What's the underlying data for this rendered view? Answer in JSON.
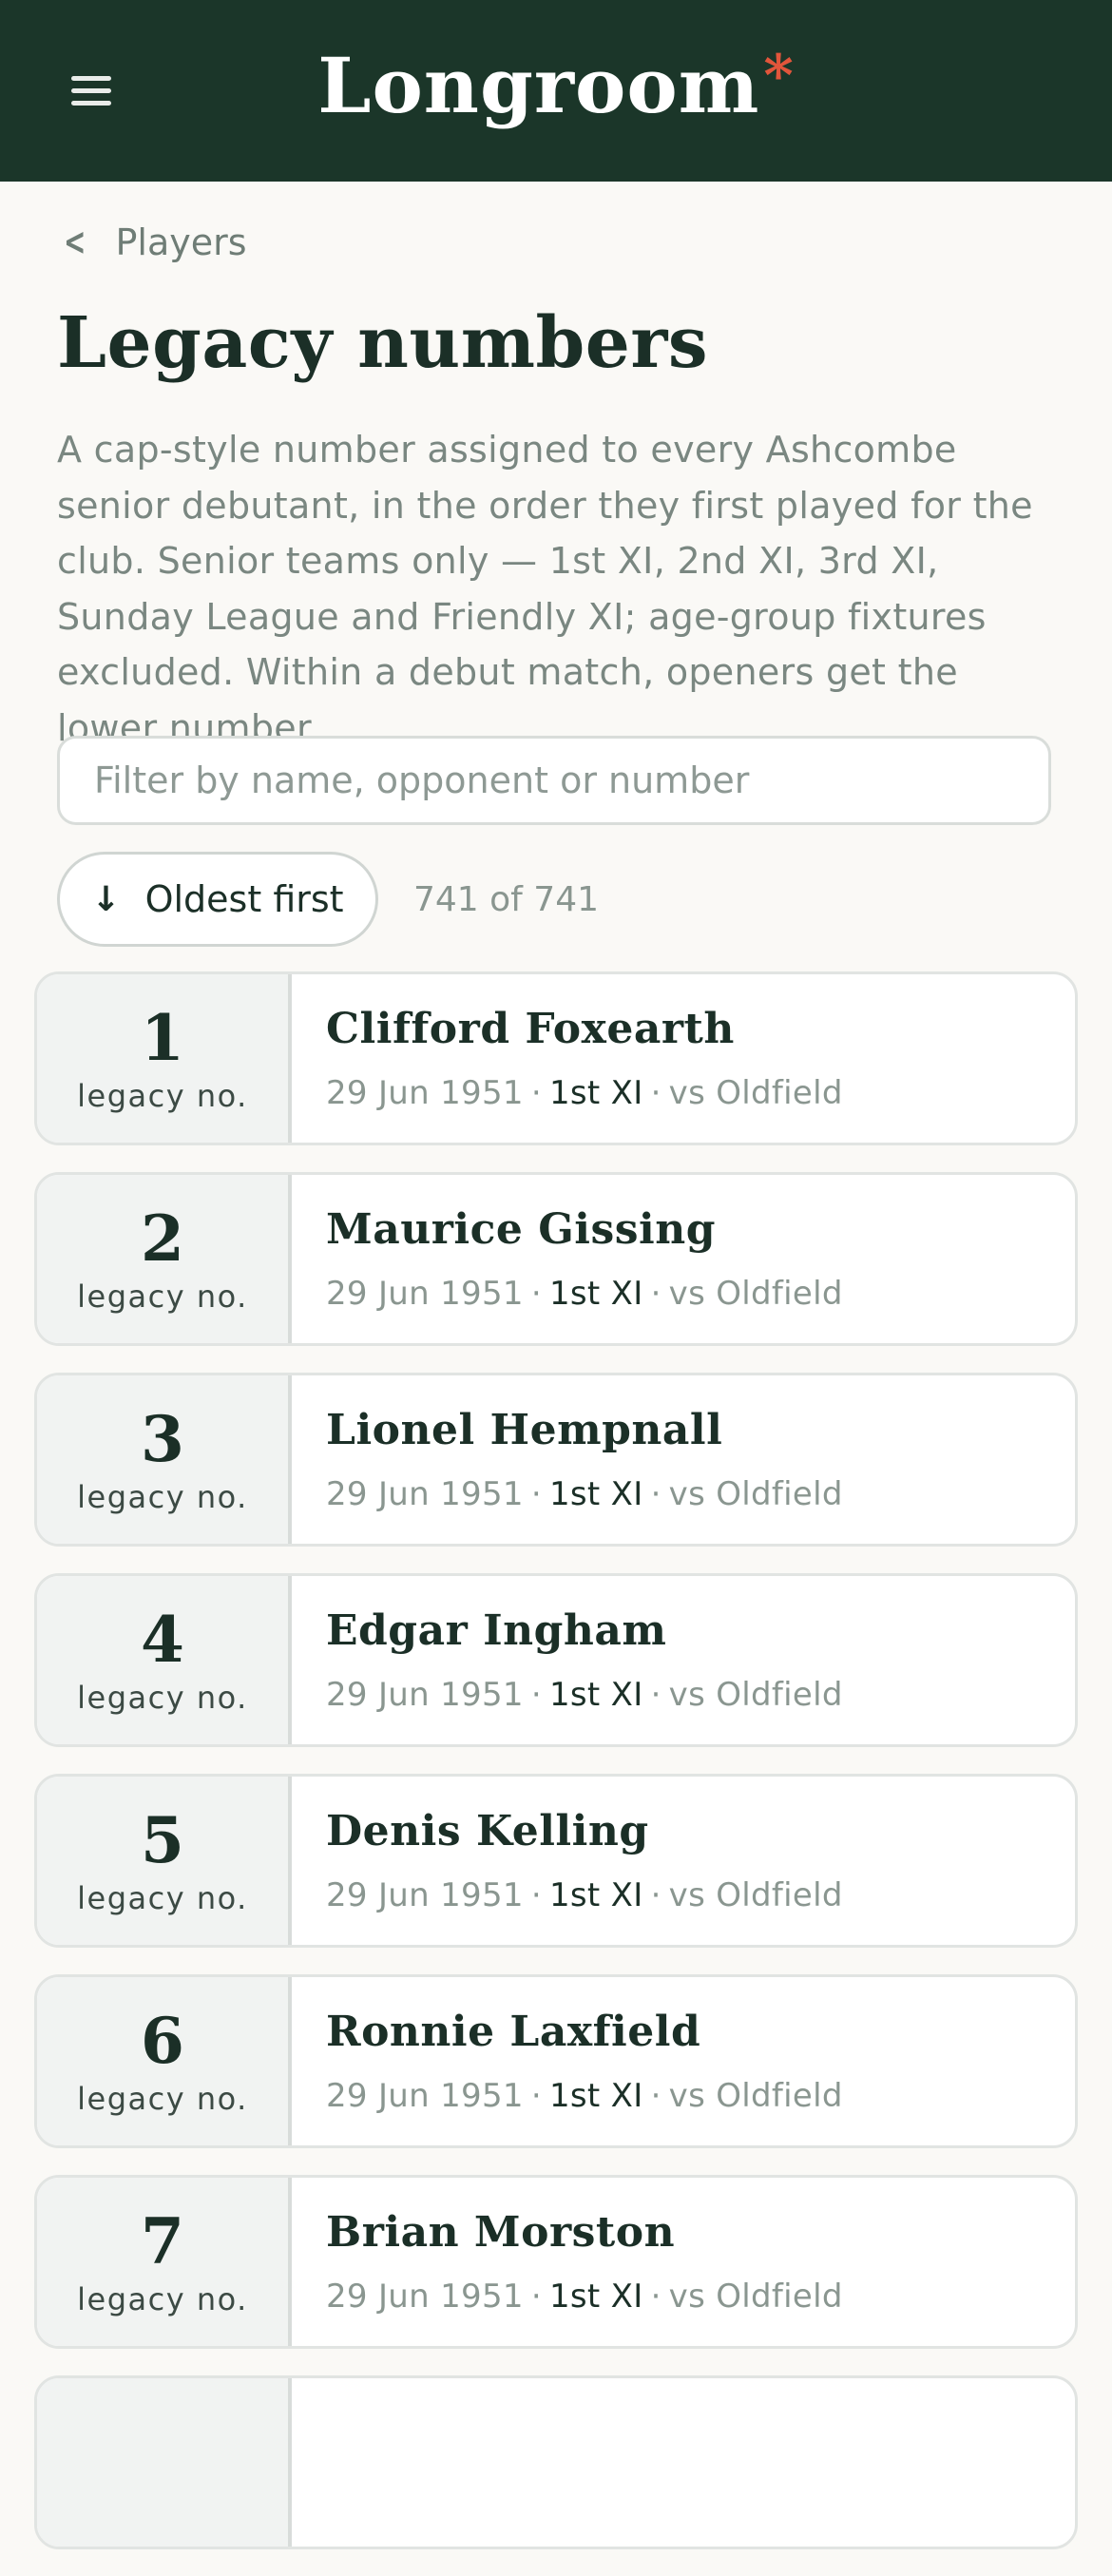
{
  "app": {
    "brand": "Longroom",
    "brand_mark": "*"
  },
  "nav": {
    "back_label": "Players"
  },
  "page": {
    "title": "Legacy numbers",
    "description": "A cap-style number assigned to every Ashcombe senior debutant, in the order they first played for the club. Senior teams only — 1st XI, 2nd XI, 3rd XI, Sunday League and Friendly XI; age-group fixtures excluded. Within a debut match, openers get the lower number."
  },
  "filter": {
    "placeholder": "Filter by name, opponent or number",
    "value": ""
  },
  "sort": {
    "label": "Oldest first",
    "count_text": "741 of 741"
  },
  "list_label": "legacy no.",
  "players": [
    {
      "number": "1",
      "name": "Clifford Foxearth",
      "date": "29 Jun 1951",
      "team": "1st XI",
      "opponent": "vs Oldfield"
    },
    {
      "number": "2",
      "name": "Maurice Gissing",
      "date": "29 Jun 1951",
      "team": "1st XI",
      "opponent": "vs Oldfield"
    },
    {
      "number": "3",
      "name": "Lionel Hempnall",
      "date": "29 Jun 1951",
      "team": "1st XI",
      "opponent": "vs Oldfield"
    },
    {
      "number": "4",
      "name": "Edgar Ingham",
      "date": "29 Jun 1951",
      "team": "1st XI",
      "opponent": "vs Oldfield"
    },
    {
      "number": "5",
      "name": "Denis Kelling",
      "date": "29 Jun 1951",
      "team": "1st XI",
      "opponent": "vs Oldfield"
    },
    {
      "number": "6",
      "name": "Ronnie Laxfield",
      "date": "29 Jun 1951",
      "team": "1st XI",
      "opponent": "vs Oldfield"
    },
    {
      "number": "7",
      "name": "Brian Morston",
      "date": "29 Jun 1951",
      "team": "1st XI",
      "opponent": "vs Oldfield"
    },
    {
      "number": "",
      "name": "",
      "date": "",
      "team": "",
      "opponent": ""
    }
  ],
  "colors": {
    "header_bg": "#1b3629",
    "accent": "#e2553b",
    "page_bg": "#faf9f6"
  }
}
